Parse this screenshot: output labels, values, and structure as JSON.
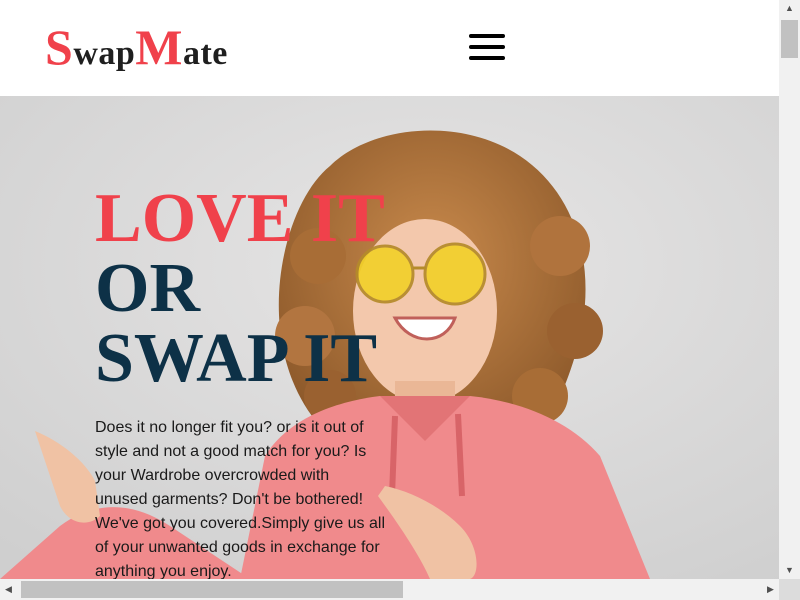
{
  "header": {
    "logo": {
      "s": "S",
      "wap": "wap",
      "m": "M",
      "ate": "ate"
    },
    "menu_icon": "hamburger-menu-icon"
  },
  "hero": {
    "headline": {
      "line1": "LOVE IT",
      "line2": "OR",
      "line3": "SWAP IT"
    },
    "description": "Does it no longer fit you? or is it out of style and not a good match for you? Is your Wardrobe overcrowded with unused garments? Don't be bothered! We've got you covered.Simply give us all of your unwanted goods in exchange for anything you enjoy."
  },
  "colors": {
    "accent": "#f0414b",
    "navy": "#0d3147",
    "hero_bg": "#dcdcdc",
    "hoodie": "#f08a8c",
    "hair": "#b8773f",
    "glasses": "#f2d02a"
  }
}
